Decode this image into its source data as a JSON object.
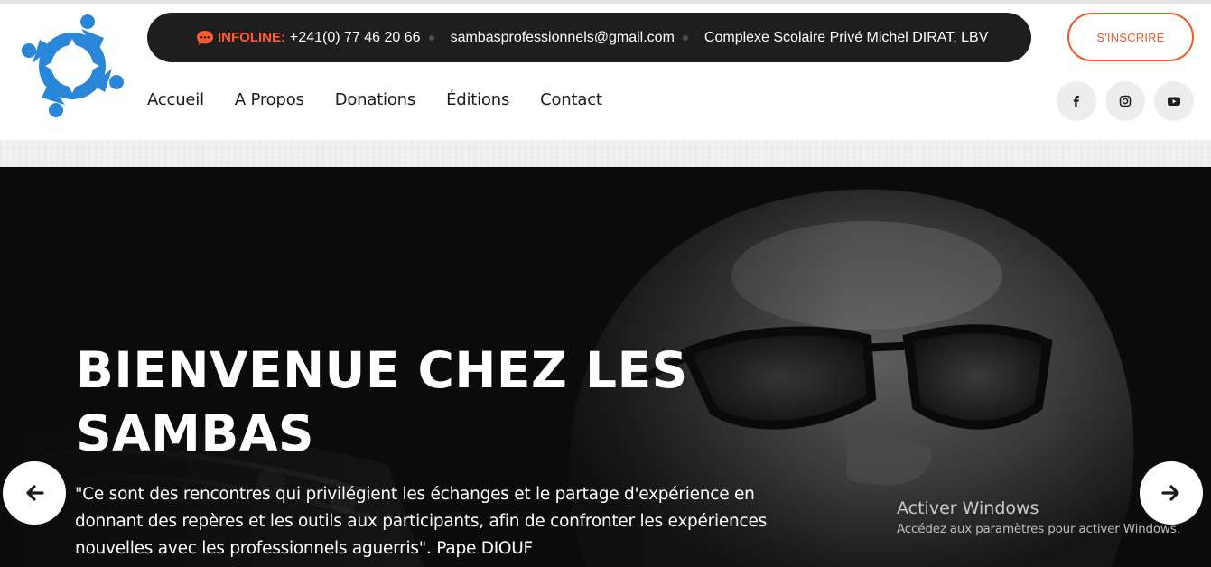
{
  "infobar": {
    "infoline_label": "INFOLINE:",
    "phone": "+241(0) 77 46 20 66",
    "email": "sambasprofessionnels@gmail.com",
    "address": "Complexe Scolaire Privé Michel DIRAT, LBV"
  },
  "nav": {
    "items": [
      "Accueil",
      "A Propos",
      "Donations",
      "Éditions",
      "Contact"
    ]
  },
  "signup_label": "S'INSCRIRE",
  "social": {
    "icons": [
      "facebook-icon",
      "instagram-icon",
      "youtube-icon"
    ]
  },
  "hero": {
    "title": "BIENVENUE CHEZ LES SAMBAS",
    "quote": "\"Ce sont des rencontres qui privilégient les échanges et le partage d'expérience en donnant des repères et les outils aux participants, afin de confronter les expériences nouvelles avec les professionnels aguerris\". Pape DIOUF"
  },
  "windows_notice": {
    "title": "Activer Windows",
    "subtitle": "Accédez aux paramètres pour activer Windows."
  },
  "colors": {
    "accent": "#f05a28",
    "infobar_bg": "#1e1e1e",
    "logo_blue": "#2f88d8",
    "hero_bg": "#0c0c0c"
  }
}
